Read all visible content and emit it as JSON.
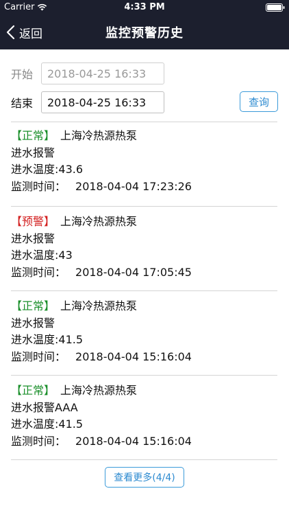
{
  "status_bar": {
    "carrier": "Carrier",
    "time": "4:33 PM"
  },
  "nav": {
    "back_label": "返回",
    "title": "监控预警历史"
  },
  "filter": {
    "start_label": "开始",
    "start_value": "2018-04-25 16:33",
    "end_label": "结束",
    "end_value": "2018-04-25 16:33",
    "query_label": "查询"
  },
  "records": [
    {
      "status": "【正常】",
      "station": "上海冷热源热泵",
      "alarm": "进水报警",
      "temperature": "进水温度:43.6",
      "time_label": "监测时间：",
      "time": "2018-04-04 17:23:26"
    },
    {
      "status": "【预警】",
      "station": "上海冷热源热泵",
      "alarm": "进水报警",
      "temperature": "进水温度:43",
      "time_label": "监测时间：",
      "time": "2018-04-04 17:05:45"
    },
    {
      "status": "【正常】",
      "station": "上海冷热源热泵",
      "alarm": "进水报警",
      "temperature": "进水温度:41.5",
      "time_label": "监测时间：",
      "time": "2018-04-04 15:16:04"
    },
    {
      "status": "【正常】",
      "station": "上海冷热源热泵",
      "alarm": "进水报警AAA",
      "temperature": "进水温度:41.5",
      "time_label": "监测时间：",
      "time": "2018-04-04 15:16:04"
    }
  ],
  "more_label": "查看更多(4/4)",
  "colors": {
    "header_bg": "#1c1f2e",
    "normal": "#1a8f2a",
    "warning": "#d32121",
    "accent": "#2c8ad0"
  }
}
